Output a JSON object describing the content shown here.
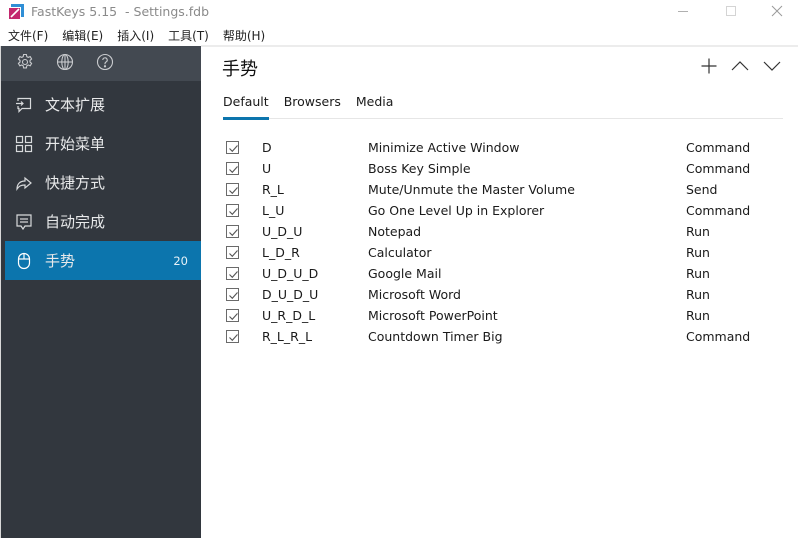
{
  "window": {
    "app_icon": "fastkeys-logo-icon",
    "title": "FastKeys 5.15  - Settings.fdb",
    "controls": [
      "minimize-icon",
      "maximize-icon",
      "close-icon"
    ]
  },
  "menubar": {
    "items": [
      "文件(F)",
      "编辑(E)",
      "插入(I)",
      "工具(T)",
      "帮助(H)"
    ]
  },
  "sidebar": {
    "tools": [
      "gear-icon",
      "globe-icon",
      "help-icon"
    ],
    "items": [
      {
        "icon": "text-expand-icon",
        "label": "文本扩展",
        "active": false
      },
      {
        "icon": "start-menu-icon",
        "label": "开始菜单",
        "active": false
      },
      {
        "icon": "shortcut-icon",
        "label": "快捷方式",
        "active": false
      },
      {
        "icon": "autocomplete-icon",
        "label": "自动完成",
        "active": false
      },
      {
        "icon": "mouse-icon",
        "label": "手势",
        "active": true,
        "count": "20"
      }
    ]
  },
  "main": {
    "title": "手势",
    "actions": [
      "plus-icon",
      "chevron-up-icon",
      "chevron-down-icon"
    ],
    "tabs": [
      {
        "label": "Default",
        "active": true
      },
      {
        "label": "Browsers",
        "active": false
      },
      {
        "label": "Media",
        "active": false
      }
    ],
    "rows": [
      {
        "checked": true,
        "gesture": "D",
        "name": "Minimize Active Window",
        "type": "Command"
      },
      {
        "checked": true,
        "gesture": "U",
        "name": "Boss Key Simple",
        "type": "Command"
      },
      {
        "checked": true,
        "gesture": "R_L",
        "name": "Mute/Unmute the Master Volume",
        "type": "Send"
      },
      {
        "checked": true,
        "gesture": "L_U",
        "name": "Go One Level Up in Explorer",
        "type": "Command"
      },
      {
        "checked": true,
        "gesture": "U_D_U",
        "name": "Notepad",
        "type": "Run"
      },
      {
        "checked": true,
        "gesture": "L_D_R",
        "name": "Calculator",
        "type": "Run"
      },
      {
        "checked": true,
        "gesture": "U_D_U_D",
        "name": "Google Mail",
        "type": "Run"
      },
      {
        "checked": true,
        "gesture": "D_U_D_U",
        "name": "Microsoft Word",
        "type": "Run"
      },
      {
        "checked": true,
        "gesture": "U_R_D_L",
        "name": "Microsoft PowerPoint",
        "type": "Run"
      },
      {
        "checked": true,
        "gesture": "R_L_R_L",
        "name": "Countdown Timer Big",
        "type": "Command"
      }
    ]
  },
  "colors": {
    "accent": "#0c75ad",
    "sidebar_bg": "#32373e",
    "sidebar_tools_bg": "#434951"
  }
}
